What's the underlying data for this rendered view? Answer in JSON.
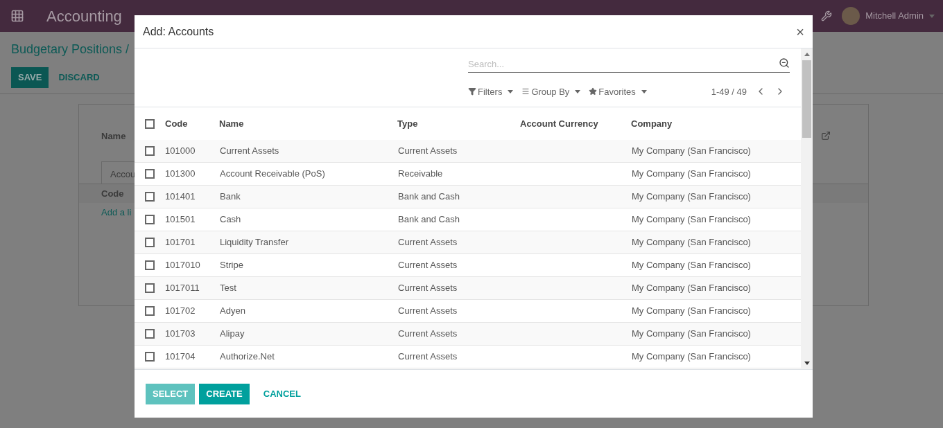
{
  "navbar": {
    "app_name": "Accounting",
    "user": "Mitchell Admin"
  },
  "page": {
    "breadcrumb": "Budgetary Positions /",
    "buttons": [
      "SAVE",
      "DISCARD"
    ],
    "name_label": "Name",
    "tab": "Accou",
    "column": "Code",
    "add_line": "Add a li"
  },
  "dialog": {
    "title": "Add: Accounts",
    "close": "×",
    "search": {
      "placeholder": "Search..."
    },
    "filters": [
      "Filters",
      "Group By",
      "Favorites"
    ],
    "pager": "1-49 / 49",
    "all_checked": false,
    "columns": [
      "Code",
      "Name",
      "Type",
      "Account Currency",
      "Company"
    ],
    "rows": [
      {
        "code": "101000",
        "name": "Current Assets",
        "type": "Current Assets",
        "company": "My Company (San Francisco)",
        "checked": false
      },
      {
        "code": "101300",
        "name": "Account Receivable (PoS)",
        "type": "Receivable",
        "company": "My Company (San Francisco)",
        "checked": false
      },
      {
        "code": "101401",
        "name": "Bank",
        "type": "Bank and Cash",
        "company": "My Company (San Francisco)",
        "checked": false
      },
      {
        "code": "101501",
        "name": "Cash",
        "type": "Bank and Cash",
        "company": "My Company (San Francisco)",
        "checked": false
      },
      {
        "code": "101701",
        "name": "Liquidity Transfer",
        "type": "Current Assets",
        "company": "My Company (San Francisco)",
        "checked": false
      },
      {
        "code": "1017010",
        "name": "Stripe",
        "type": "Current Assets",
        "company": "My Company (San Francisco)",
        "checked": false
      },
      {
        "code": "1017011",
        "name": "Test",
        "type": "Current Assets",
        "company": "My Company (San Francisco)",
        "checked": false
      },
      {
        "code": "101702",
        "name": "Adyen",
        "type": "Current Assets",
        "company": "My Company (San Francisco)",
        "checked": false
      },
      {
        "code": "101703",
        "name": "Alipay",
        "type": "Current Assets",
        "company": "My Company (San Francisco)",
        "checked": false
      },
      {
        "code": "101704",
        "name": "Authorize.Net",
        "type": "Current Assets",
        "company": "My Company (San Francisco)",
        "checked": false
      }
    ],
    "footer_buttons": [
      {
        "label": "SELECT",
        "kind": "disabled"
      },
      {
        "label": "CREATE",
        "kind": "primary"
      },
      {
        "label": "CANCEL",
        "kind": "link"
      }
    ]
  }
}
